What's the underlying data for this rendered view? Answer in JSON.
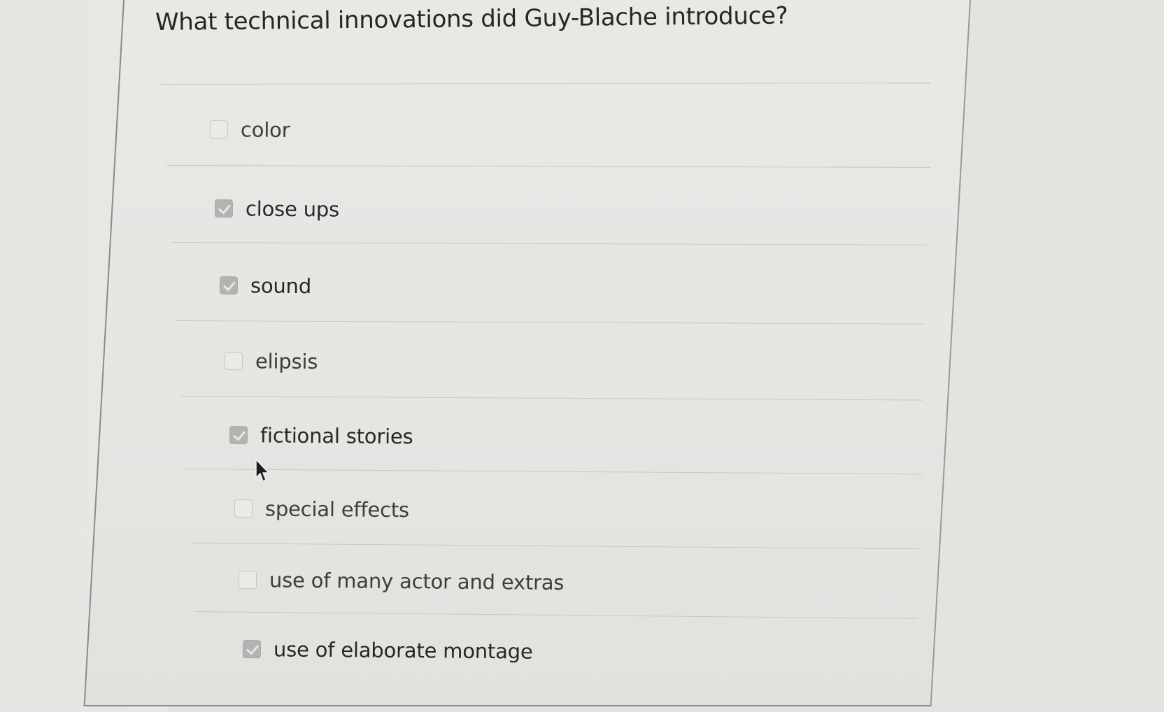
{
  "quiz": {
    "question": "What technical innovations did Guy-Blache introduce?",
    "options": [
      {
        "label": "color",
        "checked": false
      },
      {
        "label": "close ups",
        "checked": true
      },
      {
        "label": "sound",
        "checked": true
      },
      {
        "label": "elipsis",
        "checked": false
      },
      {
        "label": "fictional stories",
        "checked": true
      },
      {
        "label": "special effects",
        "checked": false
      },
      {
        "label": "use of many actor and extras",
        "checked": false
      },
      {
        "label": "use of elaborate montage",
        "checked": true
      }
    ]
  },
  "icons": {
    "cursor": "mouse-pointer-icon",
    "checked": "checkmark-icon"
  },
  "colors": {
    "background": "#e4e3e0",
    "panel_border": "#8a8a88",
    "checkbox_checked": "#b3b3b1",
    "text": "#272727"
  }
}
